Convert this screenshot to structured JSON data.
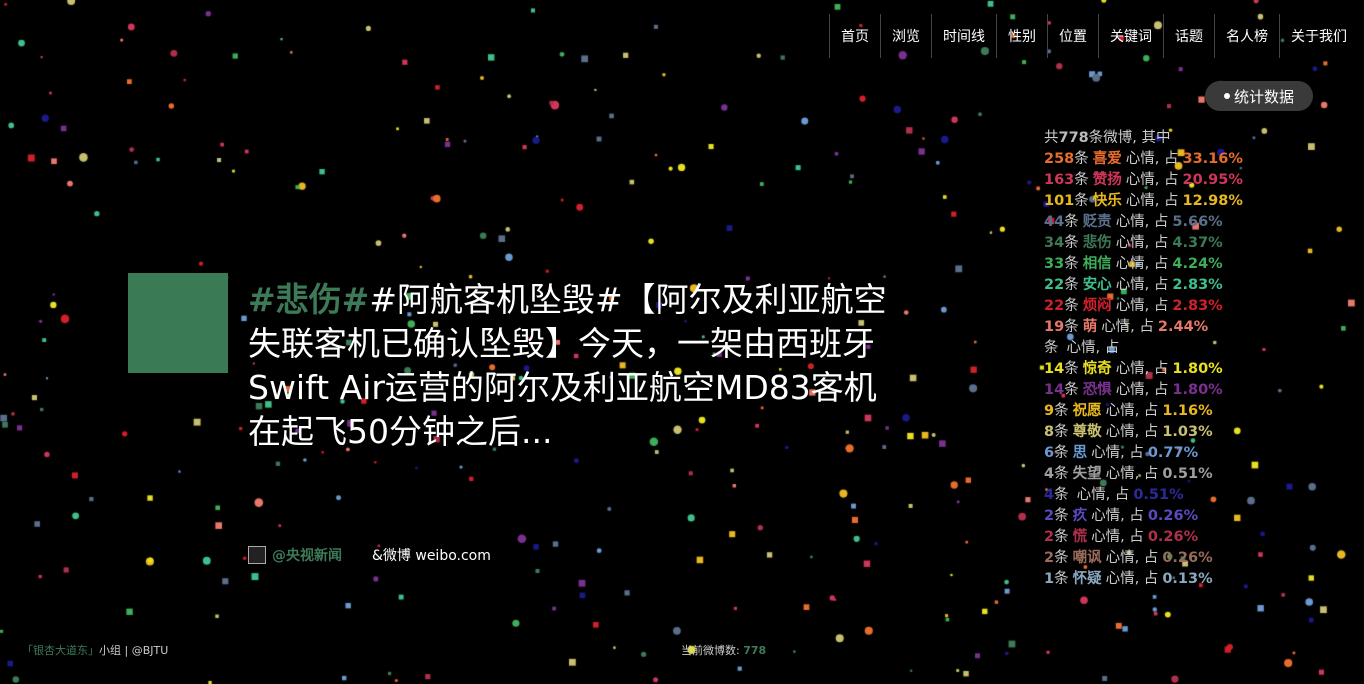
{
  "nav": [
    "首页",
    "浏览",
    "时间线",
    "性别",
    "位置",
    "关键词",
    "话题",
    "名人榜",
    "关于我们"
  ],
  "stats_button": "统计数据",
  "summary": {
    "prefix": "共",
    "total": "778",
    "suffix": "条微博, 其中"
  },
  "emotion_rows": [
    {
      "count": "258",
      "unit": "条",
      "emotion": "喜爱",
      "mid": "心情, 占",
      "pct": "33.16%",
      "color": "#e86c2d"
    },
    {
      "count": "163",
      "unit": "条",
      "emotion": "赞扬",
      "mid": "心情, 占",
      "pct": "20.95%",
      "color": "#d0365a"
    },
    {
      "count": "101",
      "unit": "条",
      "emotion": "快乐",
      "mid": "心情, 占",
      "pct": "12.98%",
      "color": "#e8b820"
    },
    {
      "count": "44",
      "unit": "条",
      "emotion": "贬责",
      "mid": "心情, 占",
      "pct": "5.66%",
      "color": "#5a6f8c"
    },
    {
      "count": "34",
      "unit": "条",
      "emotion": "悲伤",
      "mid": "心情, 占",
      "pct": "4.37%",
      "color": "#3d7a58"
    },
    {
      "count": "33",
      "unit": "条",
      "emotion": "相信",
      "mid": "心情, 占",
      "pct": "4.24%",
      "color": "#3fae5a"
    },
    {
      "count": "22",
      "unit": "条",
      "emotion": "安心",
      "mid": "心情, 占",
      "pct": "2.83%",
      "color": "#3fbf8a"
    },
    {
      "count": "22",
      "unit": "条",
      "emotion": "烦闷",
      "mid": "心情, 占",
      "pct": "2.83%",
      "color": "#d0202a"
    },
    {
      "count": "19",
      "unit": "条",
      "emotion": "萌",
      "mid": "心情, 占",
      "pct": "2.44%",
      "color": "#e8786a"
    },
    {
      "count": "",
      "unit": "条",
      "emotion": "",
      "mid": "心情, 占",
      "pct": "",
      "color": "#1a1a6a"
    },
    {
      "count": "14",
      "unit": "条",
      "emotion": "惊奇",
      "mid": "心情, 占",
      "pct": "1.80%",
      "color": "#e8e020"
    },
    {
      "count": "14",
      "unit": "条",
      "emotion": "恐惧",
      "mid": "心情, 占",
      "pct": "1.80%",
      "color": "#7a3090"
    },
    {
      "count": "9",
      "unit": "条",
      "emotion": "祝愿",
      "mid": "心情, 占",
      "pct": "1.16%",
      "color": "#e8b820"
    },
    {
      "count": "8",
      "unit": "条",
      "emotion": "尊敬",
      "mid": "心情, 占",
      "pct": "1.03%",
      "color": "#c8c070"
    },
    {
      "count": "6",
      "unit": "条",
      "emotion": "思",
      "mid": "心情, 占",
      "pct": "0.77%",
      "color": "#6a9ad0"
    },
    {
      "count": "4",
      "unit": "条",
      "emotion": "失望",
      "mid": "心情, 占",
      "pct": "0.51%",
      "color": "#a0a0a0"
    },
    {
      "count": "4",
      "unit": "条",
      "emotion": "",
      "mid": "心情, 占",
      "pct": "0.51%",
      "color": "#2a2a9a"
    },
    {
      "count": "2",
      "unit": "条",
      "emotion": "疚",
      "mid": "心情, 占",
      "pct": "0.26%",
      "color": "#5a4ac0"
    },
    {
      "count": "2",
      "unit": "条",
      "emotion": "慌",
      "mid": "心情, 占",
      "pct": "0.26%",
      "color": "#b0304a"
    },
    {
      "count": "2",
      "unit": "条",
      "emotion": "嘲讽",
      "mid": "心情, 占",
      "pct": "0.26%",
      "color": "#9a6a5a"
    },
    {
      "count": "1",
      "unit": "条",
      "emotion": "怀疑",
      "mid": "心情, 占",
      "pct": "0.13%",
      "color": "#8aa8c0"
    }
  ],
  "tweet": {
    "tag": "#悲伤#",
    "text": "#阿航客机坠毁#【阿尔及利亚航空失联客机已确认坠毁】今天，一架由西班牙Swift Air运营的阿尔及利亚航空MD83客机在起飞50分钟之后...",
    "user": "@央视新闻",
    "source": "&微博 weibo.com"
  },
  "footer": {
    "group": "「银杏大道东」",
    "rest": "小组 | @BJTU",
    "count_label": "当前微博数:",
    "count": "778"
  },
  "colors": {
    "accent": "#3d7a58",
    "avatar": "#3a7a55"
  }
}
